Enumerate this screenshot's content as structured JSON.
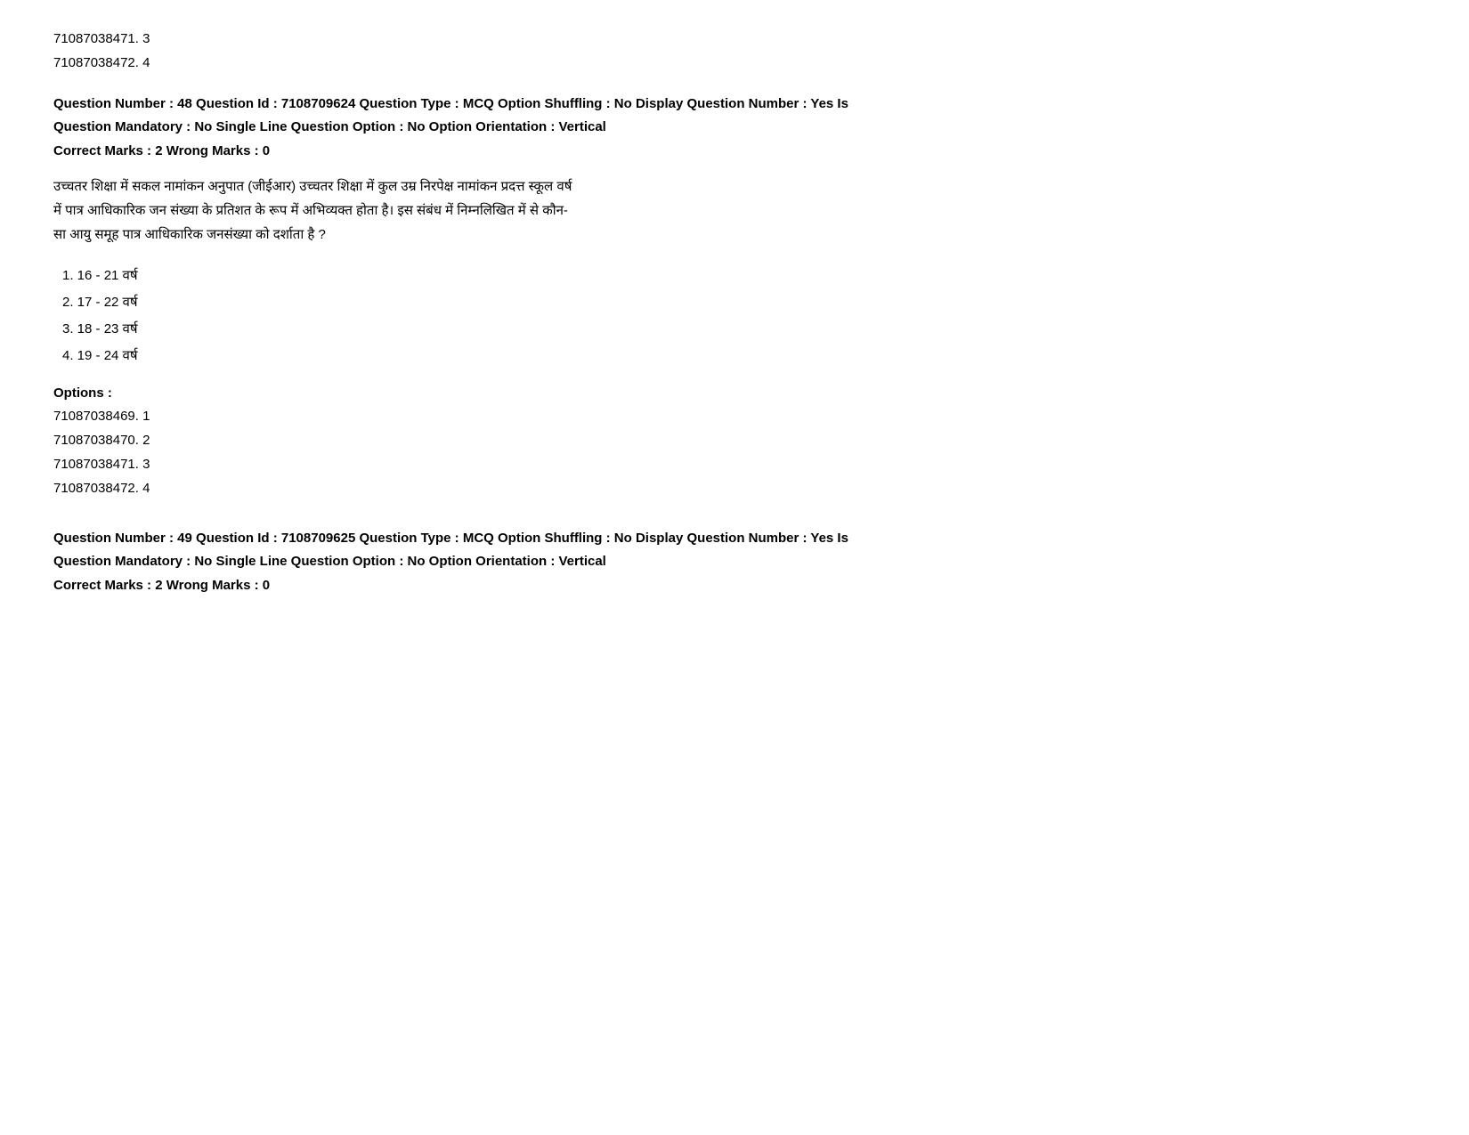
{
  "top_options_prev": {
    "opt3": "71087038471. 3",
    "opt4": "71087038472. 4"
  },
  "question48": {
    "header_line1": "Question Number : 48 Question Id : 7108709624 Question Type : MCQ Option Shuffling : No Display Question Number : Yes Is",
    "header_line2": "Question Mandatory : No Single Line Question Option : No Option Orientation : Vertical",
    "marks_line": "Correct Marks : 2 Wrong Marks : 0",
    "body_line1": "उच्चतर शिक्षा में सकल नामांकन अनुपात (जीईआर) उच्चतर शिक्षा में कुल उम्र निरपेक्ष नामांकन प्रदत्त स्कूल वर्ष",
    "body_line2": "में पात्र आधिकारिक जन संख्या के प्रतिशत के रूप में अभिव्यक्त होता है। इस संबंध में निम्नलिखित में से कौन-",
    "body_line3": "सा आयु समूह पात्र  आधिकारिक जनसंख्या को दर्शाता है ?",
    "option1": "1. 16 - 21 वर्ष",
    "option2": "2. 17 - 22 वर्ष",
    "option3": "3. 18 - 23 वर्ष",
    "option4": "4. 19 - 24 वर्ष",
    "options_label": "Options :",
    "ans_opt1": "71087038469. 1",
    "ans_opt2": "71087038470. 2",
    "ans_opt3": "71087038471. 3",
    "ans_opt4": "71087038472. 4"
  },
  "question49": {
    "header_line1": "Question Number : 49 Question Id : 7108709625 Question Type : MCQ Option Shuffling : No Display Question Number : Yes Is",
    "header_line2": "Question Mandatory : No Single Line Question Option : No Option Orientation : Vertical",
    "marks_line": "Correct Marks : 2 Wrong Marks : 0"
  }
}
